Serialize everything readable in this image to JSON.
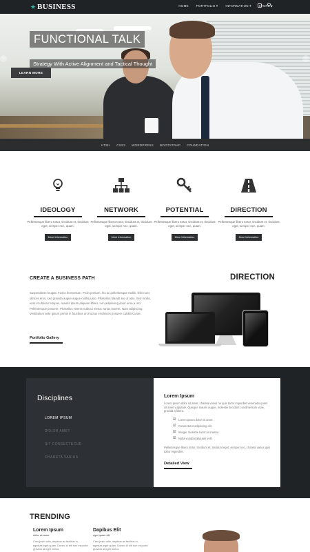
{
  "brand": {
    "logo_text": "BUSINESS",
    "accent": "#2fb3a6"
  },
  "nav": {
    "items": [
      {
        "label": "HOME"
      },
      {
        "label": "PORTFOLIO ▾"
      },
      {
        "label": "INFORMATION ▾"
      },
      {
        "label": "STORE ▾"
      }
    ],
    "icons": [
      "external-link-icon",
      "search-icon"
    ]
  },
  "hero": {
    "title": "FUNCTIONAL TALK",
    "subtitle": "Strategy With Active Alignment and Tactical Thought",
    "button": "LEARN MORE",
    "prev_icon": "‹",
    "next_icon": "›"
  },
  "techbar": {
    "items": [
      "HTML",
      "CSS3",
      "WORDPRESS",
      "BOOTSTRAP",
      "FOUNDATION"
    ]
  },
  "features": [
    {
      "icon": "lightbulb-icon",
      "title": "IDEOLOGY",
      "text": "Pellentesque libero tortor, tincidunt et, tincidunt eget, semper nec, quam.",
      "button": "More Information"
    },
    {
      "icon": "network-icon",
      "title": "NETWORK",
      "text": "Pellentesque libero tortor, tincidunt et, tincidunt eget, semper nec, quam.",
      "button": "More Information"
    },
    {
      "icon": "key-icon",
      "title": "POTENTIAL",
      "text": "Pellentesque libero tortor, tincidunt et, tincidunt eget, semper nec, quam.",
      "button": "More Information"
    },
    {
      "icon": "road-icon",
      "title": "DIRECTION",
      "text": "Pellentesque libero tortor, tincidunt et, tincidunt eget, semper nec, quam.",
      "button": "More Information"
    }
  ],
  "business_path": {
    "title": "CREATE A BUSINESS PATH",
    "text": "Suspendisse feugiat. Fusce fermentum. Proin pretium, leo ac pellentesque mollis, felis nunc ultrices eros, sed gravida augue augue mollis justo. Phasellus blandit leo ut odio. Sed mollis, eros et ultrices tempus, mauris ipsum aliquam libero, non adipiscing dolor urna a orci. Pellentesque posuere. Phasellus viverra nulla ut metus varius laoreet. Nam adipiscing. Vestibulum ante ipsum primis in faucibus orci luctus et ultrices posuere cubilia Curae.",
    "link": "Portfolio Gallery",
    "heading_right": "DIRECTION"
  },
  "disciplines": {
    "title": "Disciplines",
    "items": [
      "LOREM IPSUM",
      "DOLOR AMET",
      "SIT CONSECTECUR",
      "CHARETA VARIUS"
    ],
    "active_index": 0,
    "content": {
      "title": "Lorem Ipsum",
      "text": "Lorem ipsum dolor sit amet, chareta varius no quis tortor imperdiet venenatis quam sit amet vulputate. Quisque mauris augue, molestie tincidunt condimentum vitae, gravida a libero.",
      "checklist": [
        "Lorem ipsum dolor sit amet",
        "Consectetur adipiscing elit",
        "Integer molestie lorem at massa",
        "Nulla volutpat aliquam velit"
      ],
      "text2": "Pellentesque libero tortor, tincidunt et, tincidunt eget, semper nec, chareta varius quis tortor imperdiet.",
      "link": "Detailed View"
    }
  },
  "trending": {
    "title": "TRENDING",
    "items": [
      {
        "name": "Lorem Ipsum",
        "role": "dolor sit amet",
        "text": "Cras justo odio, dapibus ac facilisis in, egestas eget quam. Donec id elit non mi porta gravida at eget metus."
      },
      {
        "name": "Dapibus Elit",
        "role": "eget quam elit",
        "text": "Cras justo odio, dapibus ac facilisis in, egestas eget quam. Donec id elit non mi porta gravida at eget metus."
      }
    ]
  }
}
